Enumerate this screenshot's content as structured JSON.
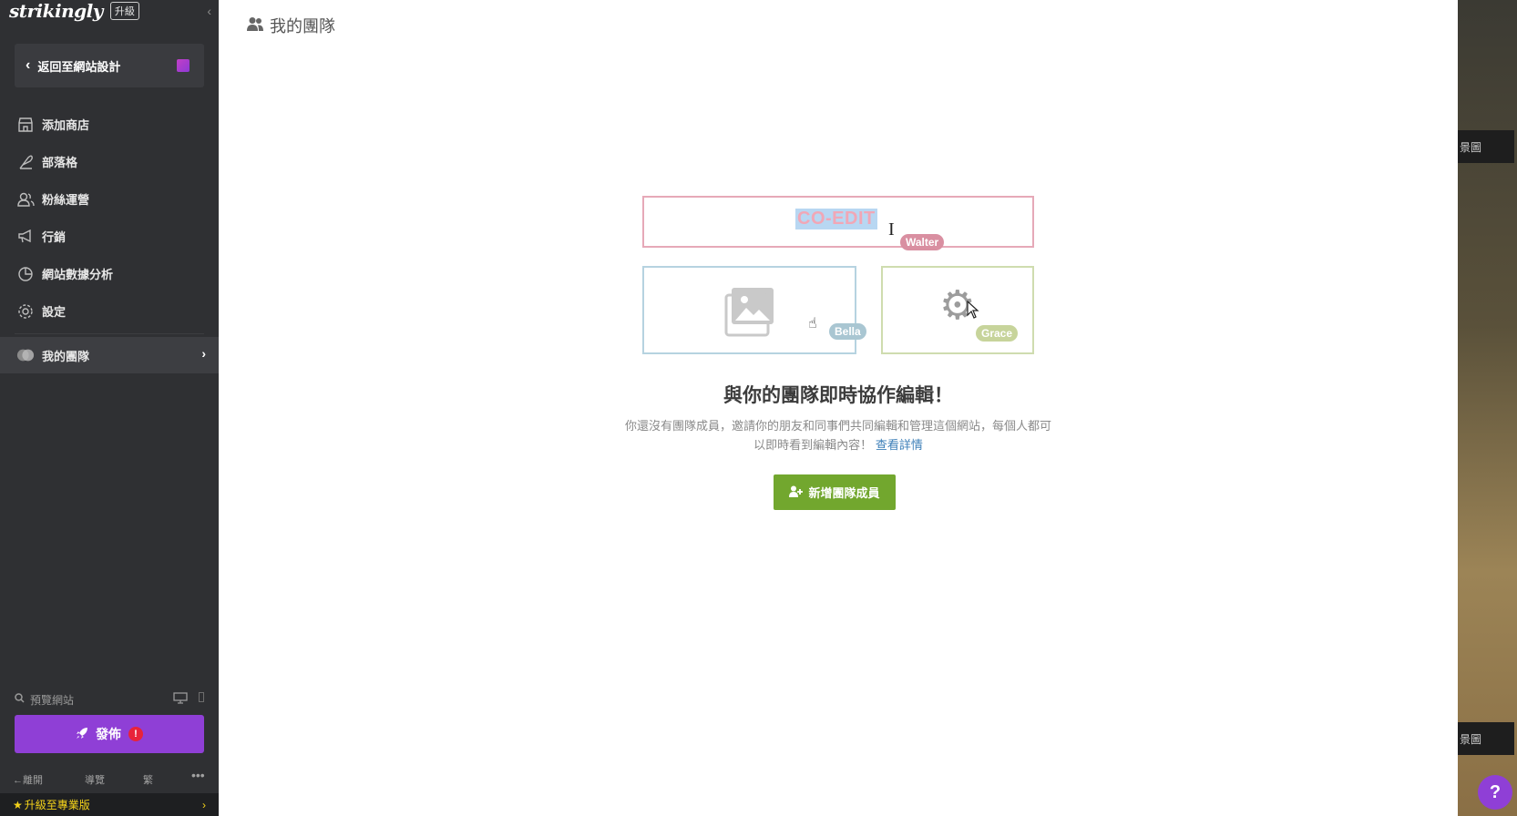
{
  "sidebar": {
    "brand": "strikingly",
    "upgrade_badge": "升級",
    "back_label": "返回至網站設計",
    "items": [
      {
        "label": "添加商店",
        "icon": "store-icon"
      },
      {
        "label": "部落格",
        "icon": "feather-icon"
      },
      {
        "label": "粉絲運營",
        "icon": "users-icon"
      },
      {
        "label": "行銷",
        "icon": "megaphone-icon"
      },
      {
        "label": "網站數據分析",
        "icon": "pie-chart-icon"
      },
      {
        "label": "設定",
        "icon": "gear-icon"
      }
    ],
    "active_item": {
      "label": "我的團隊",
      "icon": "team-icon"
    },
    "preview_label": "預覽網站",
    "publish_label": "發佈",
    "publish_alert": "!",
    "bottom": {
      "exit": "離開",
      "guide": "導覽",
      "lang": "繁",
      "more": "•••"
    },
    "pro_upgrade": "升級至專業版"
  },
  "main": {
    "title": "我的團隊",
    "illustration": {
      "coedit_text": "CO-EDIT",
      "users": [
        "Walter",
        "Bella",
        "Grace"
      ]
    },
    "headline": "與你的團隊即時協作編輯！",
    "description_line1": "你還沒有團隊成員，邀請你的朋友和同事們共同編輯和管理這個網站，每個人都可",
    "description_line2": "以即時看到編輯內容！",
    "details_link": "查看詳情",
    "add_member_button": "新增團隊成員"
  },
  "right_strip": {
    "button1": "景圖",
    "button2": "景圖",
    "help": "?"
  },
  "colors": {
    "sidebar_bg": "#2f3033",
    "publish_purple": "#8f3fd6",
    "add_green": "#72a72e",
    "pro_yellow": "#f4d21a",
    "link_blue": "#3d7fb8"
  }
}
